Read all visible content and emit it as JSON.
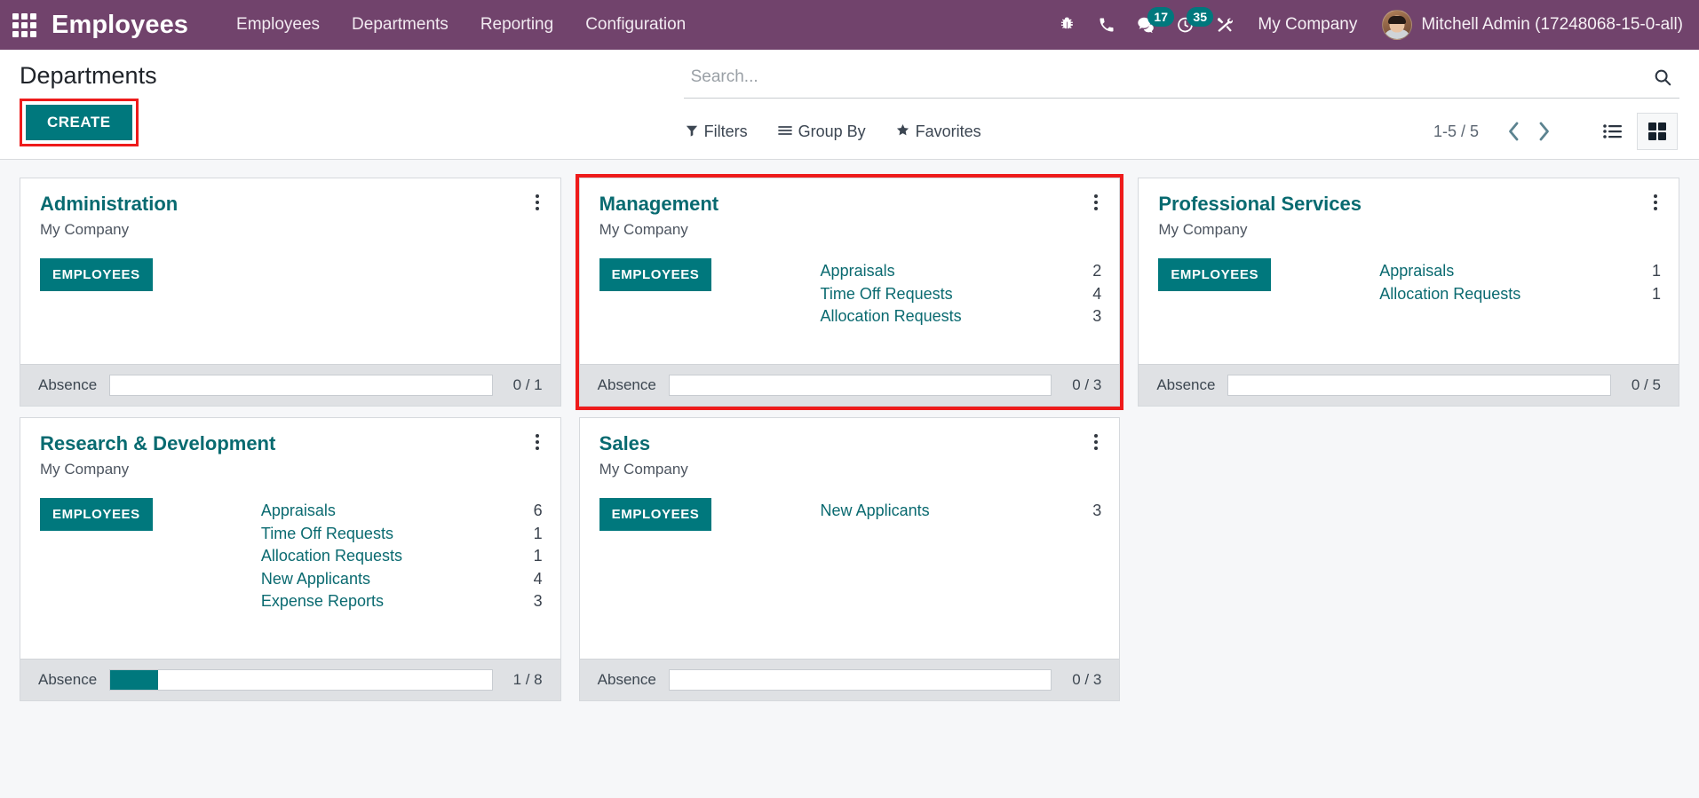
{
  "navbar": {
    "apps_icon": "apps-grid-icon",
    "brand": "Employees",
    "menu": [
      {
        "label": "Employees"
      },
      {
        "label": "Departments"
      },
      {
        "label": "Reporting"
      },
      {
        "label": "Configuration"
      }
    ],
    "icons": [
      {
        "name": "bug-icon",
        "badge": ""
      },
      {
        "name": "phone-icon",
        "badge": ""
      },
      {
        "name": "messages-icon",
        "badge": "17"
      },
      {
        "name": "activities-clock-icon",
        "badge": "35"
      },
      {
        "name": "developer-tools-icon",
        "badge": ""
      }
    ],
    "company": "My Company",
    "user": "Mitchell Admin (17248068-15-0-all)",
    "bg_color": "#71436c",
    "badge_color": "#00787d"
  },
  "control_panel": {
    "page_title": "Departments",
    "create_label": "CREATE",
    "create_highlight_color": "#ee1b1b",
    "search": {
      "placeholder": "Search...",
      "value": "",
      "icon": "search-icon"
    },
    "filters": [
      {
        "label": "Filters",
        "icon": "filter-funnel-icon"
      },
      {
        "label": "Group By",
        "icon": "group-by-lines-icon"
      },
      {
        "label": "Favorites",
        "icon": "star-icon"
      }
    ],
    "pager": {
      "count": "1-5 / 5",
      "previous_icon": "chevron-left-icon",
      "next_icon": "chevron-right-icon"
    },
    "views": [
      {
        "name": "list-view",
        "icon": "list-icon",
        "active": false
      },
      {
        "name": "kanban-view",
        "icon": "kanban-grid-icon",
        "active": true
      }
    ]
  },
  "kanban": {
    "employees_button_label": "EMPLOYEES",
    "absence_label": "Absence",
    "accent_color": "#00787d",
    "title_color": "#086a70",
    "cards": [
      {
        "title": "Administration",
        "company": "My Company",
        "stats": [],
        "absence": {
          "value": "0 / 1",
          "percent": 0
        },
        "highlighted": false,
        "tall": false
      },
      {
        "title": "Management",
        "company": "My Company",
        "stats": [
          {
            "label": "Appraisals",
            "value": "2"
          },
          {
            "label": "Time Off Requests",
            "value": "4"
          },
          {
            "label": "Allocation Requests",
            "value": "3"
          }
        ],
        "absence": {
          "value": "0 / 3",
          "percent": 0
        },
        "highlighted": true,
        "tall": false
      },
      {
        "title": "Professional Services",
        "company": "My Company",
        "stats": [
          {
            "label": "Appraisals",
            "value": "1"
          },
          {
            "label": "Allocation Requests",
            "value": "1"
          }
        ],
        "absence": {
          "value": "0 / 5",
          "percent": 0
        },
        "highlighted": false,
        "tall": false
      },
      {
        "title": "Research & Development",
        "company": "My Company",
        "stats": [
          {
            "label": "Appraisals",
            "value": "6"
          },
          {
            "label": "Time Off Requests",
            "value": "1"
          },
          {
            "label": "Allocation Requests",
            "value": "1"
          },
          {
            "label": "New Applicants",
            "value": "4"
          },
          {
            "label": "Expense Reports",
            "value": "3"
          }
        ],
        "absence": {
          "value": "1 / 8",
          "percent": 12.5
        },
        "highlighted": false,
        "tall": true
      },
      {
        "title": "Sales",
        "company": "My Company",
        "stats": [
          {
            "label": "New Applicants",
            "value": "3"
          }
        ],
        "absence": {
          "value": "0 / 3",
          "percent": 0
        },
        "highlighted": false,
        "tall": true
      }
    ]
  }
}
